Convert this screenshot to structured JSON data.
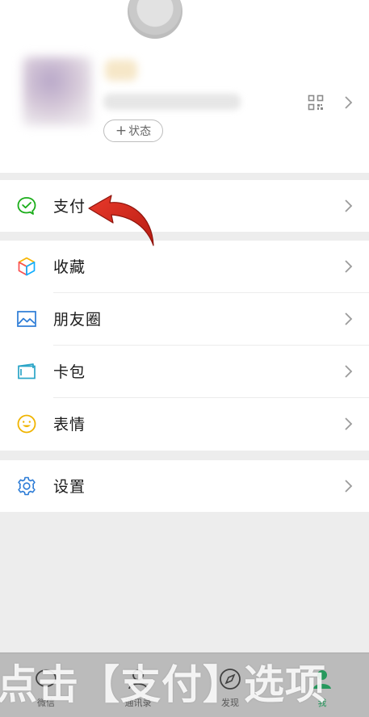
{
  "profile": {
    "status_label": "状态"
  },
  "menu": {
    "pay": "支付",
    "favorites": "收藏",
    "moments": "朋友圈",
    "cards": "卡包",
    "stickers": "表情",
    "settings": "设置"
  },
  "tabbar": {
    "chats": "微信",
    "contacts": "通讯录",
    "discover": "发现",
    "me": "我"
  },
  "caption": "点击【支付】选项",
  "colors": {
    "accent": "#07c160",
    "pay_icon": "#1aad19",
    "arrow": "#d6281c"
  }
}
